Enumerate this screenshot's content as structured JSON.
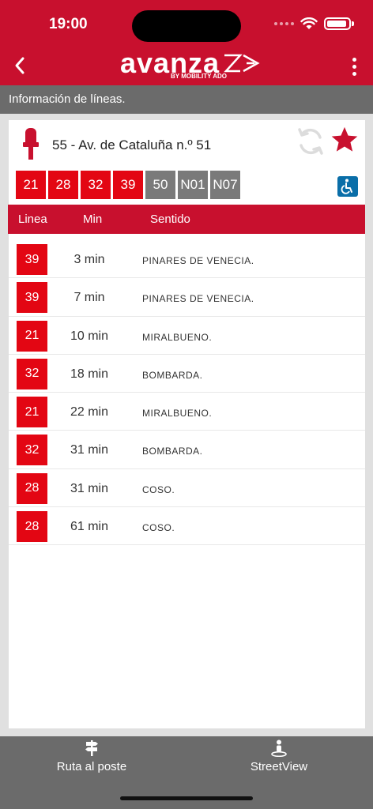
{
  "status_bar": {
    "time": "19:00"
  },
  "header": {
    "logo_word": "avanza",
    "logo_sub": "BY MOBILITY ADO"
  },
  "subheader": {
    "title": "Información de líneas."
  },
  "stop": {
    "name": "55 - Av. de Cataluña n.º 51",
    "favorite": true
  },
  "lines": [
    {
      "label": "21",
      "active": true
    },
    {
      "label": "28",
      "active": true
    },
    {
      "label": "32",
      "active": true
    },
    {
      "label": "39",
      "active": true
    },
    {
      "label": "50",
      "active": false
    },
    {
      "label": "N01",
      "active": false
    },
    {
      "label": "N07",
      "active": false
    }
  ],
  "table": {
    "headers": {
      "linea": "Linea",
      "min": "Min",
      "sentido": "Sentido"
    },
    "rows": [
      {
        "line": "39",
        "min": "3 min",
        "destination": "PINARES DE VENECIA."
      },
      {
        "line": "39",
        "min": "7 min",
        "destination": "PINARES DE VENECIA."
      },
      {
        "line": "21",
        "min": "10 min",
        "destination": "MIRALBUENO."
      },
      {
        "line": "32",
        "min": "18 min",
        "destination": "BOMBARDA."
      },
      {
        "line": "21",
        "min": "22 min",
        "destination": "MIRALBUENO."
      },
      {
        "line": "32",
        "min": "31 min",
        "destination": "BOMBARDA."
      },
      {
        "line": "28",
        "min": "31 min",
        "destination": "COSO."
      },
      {
        "line": "28",
        "min": "61 min",
        "destination": "COSO."
      }
    ]
  },
  "bottom_bar": {
    "route_label": "Ruta al poste",
    "streetview_label": "StreetView"
  },
  "colors": {
    "brand_red": "#c8102e",
    "chip_red": "#e30613",
    "chip_gray": "#7a7a7a",
    "bar_gray": "#6b6b6b",
    "accessible_blue": "#0a6ea8"
  },
  "icons": {
    "back": "chevron-left-icon",
    "menu": "more-vertical-icon",
    "stop": "bus-stop-icon",
    "refresh": "refresh-icon",
    "favorite": "star-icon",
    "accessible": "wheelchair-icon",
    "route": "signpost-icon",
    "streetview": "pegman-icon"
  }
}
